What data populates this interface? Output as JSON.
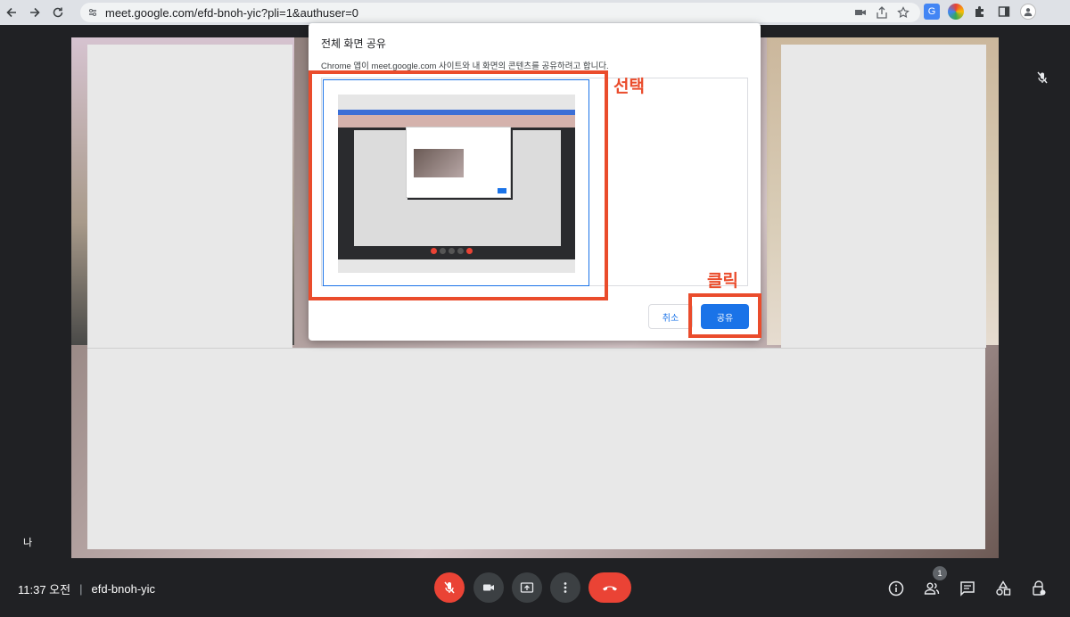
{
  "browser": {
    "url": "meet.google.com/efd-bnoh-yic?pli=1&authuser=0"
  },
  "dialog": {
    "title": "전체 화면 공유",
    "description": "Chrome 앱이 meet.google.com 사이트와 내 화면의 콘텐츠를 공유하려고 합니다.",
    "cancel_label": "취소",
    "share_label": "공유"
  },
  "annotations": {
    "select_label": "선택",
    "click_label": "클릭",
    "color": "#ea4c2c"
  },
  "video": {
    "self_label": "나"
  },
  "meeting": {
    "time": "11:37 오전",
    "separator": "|",
    "code": "efd-bnoh-yic",
    "participants_count": "1"
  },
  "colors": {
    "accent": "#1a73e8",
    "danger": "#ea4335",
    "background": "#202124"
  }
}
